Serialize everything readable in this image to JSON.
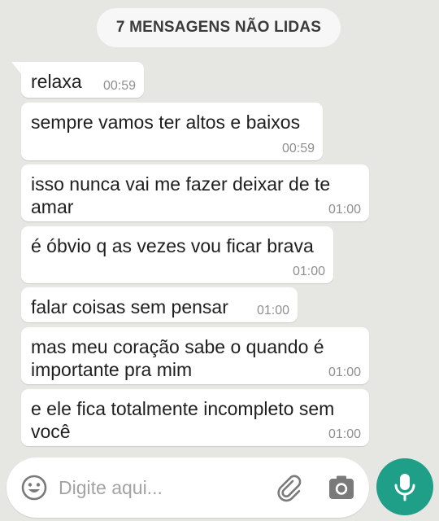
{
  "unread_banner": "7 MENSAGENS NÃO LIDAS",
  "messages": [
    {
      "text": "relaxa",
      "time": "00:59"
    },
    {
      "text": "sempre vamos ter altos e baixos",
      "time": "00:59"
    },
    {
      "text": "isso nunca vai me fazer deixar de te amar",
      "time": "01:00"
    },
    {
      "text": "é óbvio q as vezes vou ficar brava",
      "time": "01:00"
    },
    {
      "text": "falar coisas sem pensar",
      "time": "01:00"
    },
    {
      "text": "mas meu coração sabe o quando é importante pra mim",
      "time": "01:00"
    },
    {
      "text": "e ele fica totalmente incompleto sem você",
      "time": "01:00"
    }
  ],
  "composer": {
    "placeholder": "Digite aqui...",
    "icons": {
      "emoji": "emoji-icon",
      "attach": "paperclip-icon",
      "camera": "camera-icon",
      "mic": "microphone-icon"
    }
  },
  "colors": {
    "background": "#e6e6e3",
    "bubble": "#ffffff",
    "mic_button": "#1f9e88",
    "icon_gray": "#7a7a7a"
  }
}
